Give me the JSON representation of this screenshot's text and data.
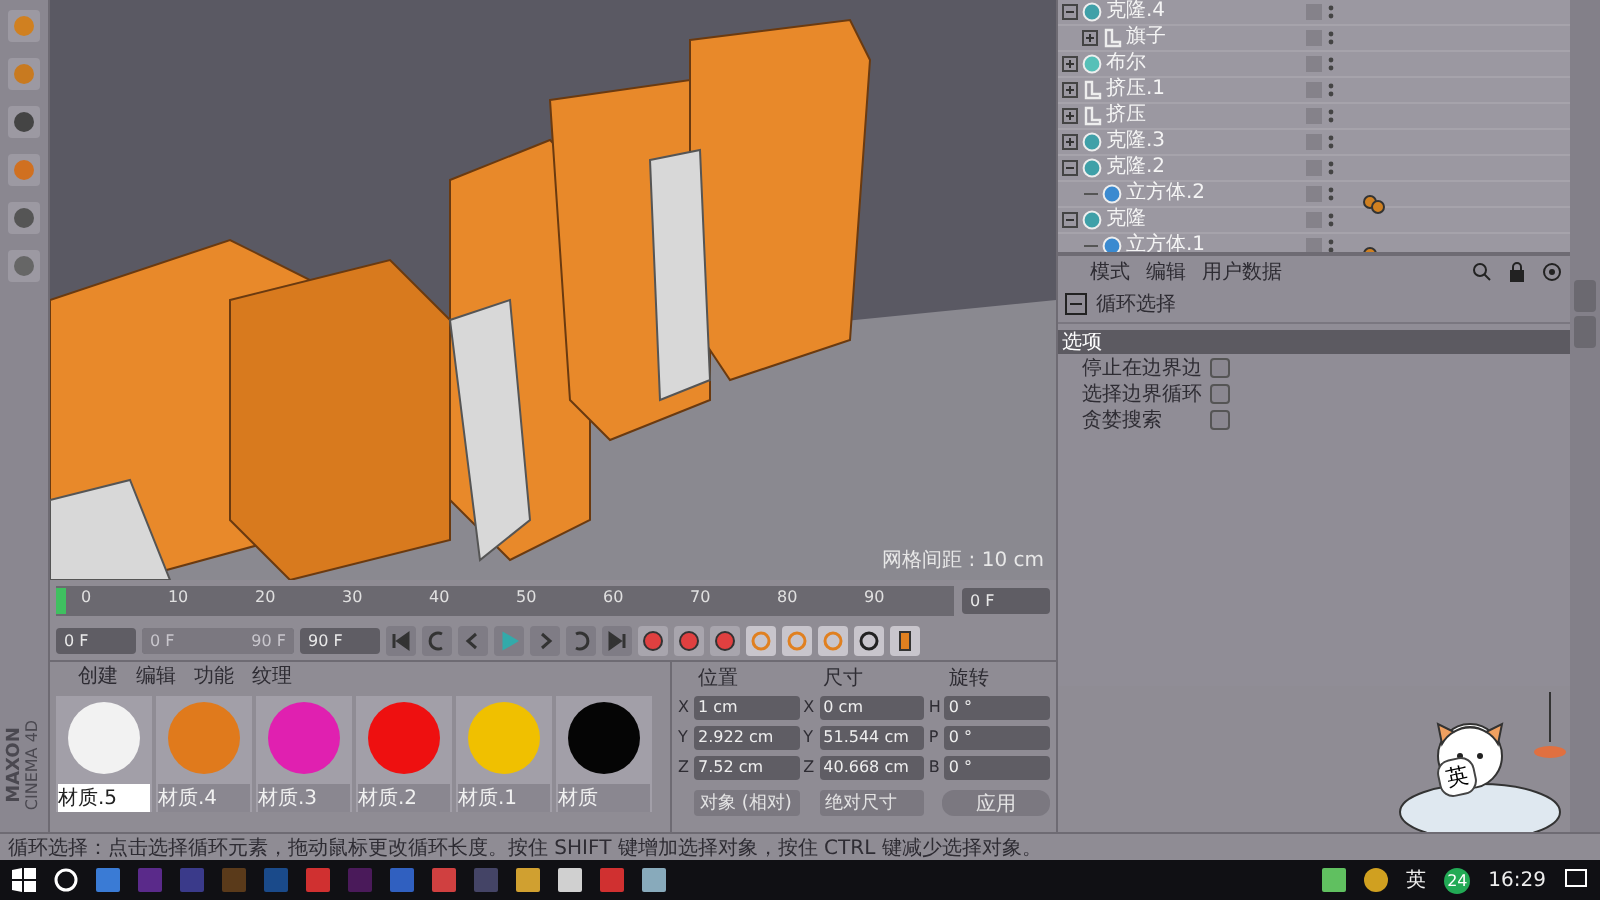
{
  "objects": [
    {
      "name": "克隆.4",
      "kind": "cloner",
      "expanded": true,
      "tagged": false,
      "children": [
        {
          "name": "旗子",
          "kind": "extrude",
          "expanded": false,
          "tagged": false
        }
      ]
    },
    {
      "name": "布尔",
      "kind": "boole",
      "expanded": false,
      "tagged": false
    },
    {
      "name": "挤压.1",
      "kind": "extrude",
      "expanded": false,
      "tagged": false
    },
    {
      "name": "挤压",
      "kind": "extrude",
      "expanded": false,
      "tagged": false
    },
    {
      "name": "克隆.3",
      "kind": "cloner",
      "expanded": false,
      "tagged": false
    },
    {
      "name": "克隆.2",
      "kind": "cloner",
      "expanded": true,
      "tagged": false,
      "children": [
        {
          "name": "立方体.2",
          "kind": "cube",
          "tagged": true
        }
      ]
    },
    {
      "name": "克隆",
      "kind": "cloner",
      "expanded": true,
      "tagged": false,
      "children": [
        {
          "name": "立方体.1",
          "kind": "cube",
          "tagged": true
        }
      ]
    }
  ],
  "attributes": {
    "menu": [
      "模式",
      "编辑",
      "用户数据"
    ],
    "title": "循环选择",
    "section": "选项",
    "options": [
      {
        "label": "停止在边界边",
        "checked": false
      },
      {
        "label": "选择边界循环",
        "checked": false
      },
      {
        "label": "贪婪搜索",
        "checked": false
      }
    ]
  },
  "viewport": {
    "grid_label": "网格间距 : 10 cm"
  },
  "timeline": {
    "ticks": [
      "0",
      "10",
      "20",
      "30",
      "40",
      "50",
      "60",
      "70",
      "80",
      "90"
    ],
    "level": 0,
    "frame": "0 F"
  },
  "transport": {
    "start": "0 F",
    "range": {
      "start": "0 F",
      "end": "90 F",
      "level": 1
    },
    "end": "90 F"
  },
  "materials": {
    "menu": [
      "创建",
      "编辑",
      "功能",
      "纹理"
    ],
    "items": [
      {
        "name": "材质.5",
        "color": "#f2f2f2",
        "selected": true
      },
      {
        "name": "材质.4",
        "color": "#e07a1c",
        "selected": false
      },
      {
        "name": "材质.3",
        "color": "#e020b0",
        "selected": false
      },
      {
        "name": "材质.2",
        "color": "#ee1010",
        "selected": false
      },
      {
        "name": "材质.1",
        "color": "#f0c000",
        "selected": false
      },
      {
        "name": "材质",
        "color": "#050505",
        "selected": false
      }
    ]
  },
  "coordinates": {
    "headers": [
      "位置",
      "尺寸",
      "旋转"
    ],
    "rows": [
      {
        "cells": [
          {
            "axis": "X",
            "value": "1 cm"
          },
          {
            "axis": "X",
            "value": "0 cm"
          },
          {
            "axis": "H",
            "value": "0 °"
          }
        ]
      },
      {
        "cells": [
          {
            "axis": "Y",
            "value": "2.922 cm"
          },
          {
            "axis": "Y",
            "value": "51.544 cm"
          },
          {
            "axis": "P",
            "value": "0 °"
          }
        ]
      },
      {
        "cells": [
          {
            "axis": "Z",
            "value": "7.52 cm"
          },
          {
            "axis": "Z",
            "value": "40.668 cm"
          },
          {
            "axis": "B",
            "value": "0 °"
          }
        ]
      }
    ],
    "mode": "对象 (相对)",
    "size_mode": "绝对尺寸",
    "apply": "应用"
  },
  "logo": {
    "brand": "MAXON",
    "product": "CINEMA 4D"
  },
  "status_bar": "循环选择：点击选择循环元素，拖动鼠标更改循环长度。按住 SHIFT 键增加选择对象，按住 CTRL 键减少选择对象。",
  "mascot": {
    "bubble": "英"
  },
  "taskbar": {
    "language": "英",
    "badge": "24",
    "time": "16:29"
  }
}
